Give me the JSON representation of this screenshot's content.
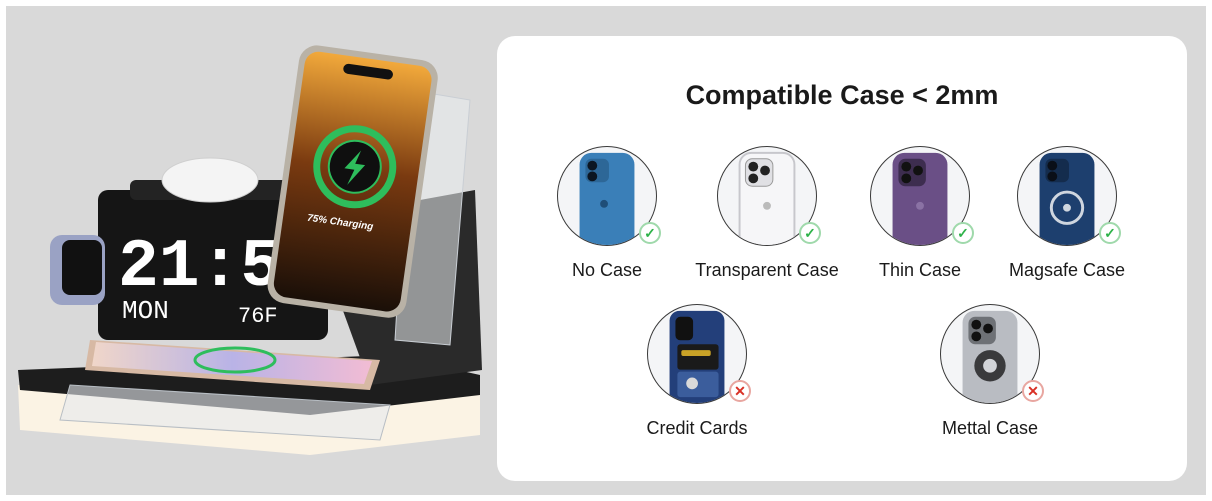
{
  "header": {
    "title": "Compatible Case < 2mm"
  },
  "product": {
    "clock_time": "21:5",
    "clock_day": "MON",
    "clock_temp": "76F",
    "phone_status": "75% Charging"
  },
  "cases": [
    {
      "label": "No Case",
      "compatible": true,
      "icon": "check-icon"
    },
    {
      "label": "Transparent Case",
      "compatible": true,
      "icon": "check-icon"
    },
    {
      "label": "Thin Case",
      "compatible": true,
      "icon": "check-icon"
    },
    {
      "label": "Magsafe Case",
      "compatible": true,
      "icon": "check-icon"
    },
    {
      "label": "Credit Cards",
      "compatible": false,
      "icon": "cross-icon"
    },
    {
      "label": "Mettal Case",
      "compatible": false,
      "icon": "cross-icon"
    }
  ],
  "colors": {
    "ok": "#2fb34a",
    "no": "#d93025",
    "background": "#d9d9d9"
  }
}
